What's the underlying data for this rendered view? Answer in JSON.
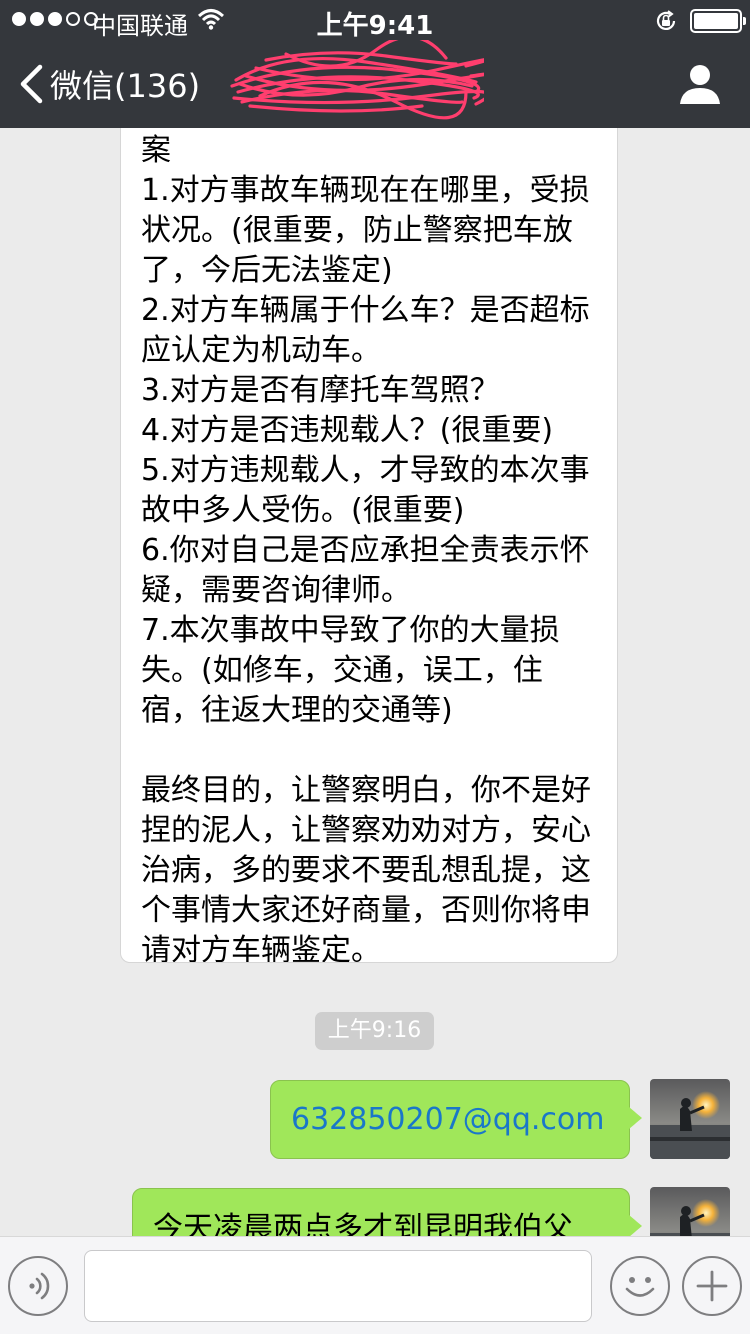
{
  "status_bar": {
    "carrier": "中国联通",
    "time": "上午9:41"
  },
  "nav": {
    "back_label": "微信(136)"
  },
  "messages": {
    "incoming_text": "案\n1.对方事故车辆现在在哪里，受损状况。(很重要，防止警察把车放了，今后无法鉴定)\n2.对方车辆属于什么车？是否超标应认定为机动车。\n3.对方是否有摩托车驾照？\n4.对方是否违规载人？(很重要)\n5.对方违规载人，才导致的本次事故中多人受伤。(很重要)\n6.你对自己是否应承担全责表示怀疑，需要咨询律师。\n7.本次事故中导致了你的大量损失。(如修车，交通，误工，住宿，往返大理的交通等)\n\n最终目的，让警察明白，你不是好捏的泥人，让警察劝劝对方，安心治病，多的要求不要乱想乱提，这个事情大家还好商量，否则你将申请对方车辆鉴定。",
    "timestamp": "上午9:16",
    "outgoing_email": "632850207@qq.com",
    "outgoing_text2": "今天凌晨两点多才到昆明我伯父"
  },
  "icons": {
    "wifi": "wifi-icon",
    "lock": "rotation-lock-icon",
    "battery": "battery-icon",
    "back": "chevron-left-icon",
    "profile": "person-icon",
    "voice": "voice-icon",
    "emoji": "emoji-icon",
    "plus": "plus-icon"
  },
  "colors": {
    "nav_background": "#34373c",
    "chat_background": "#ebebeb",
    "outgoing_bubble": "#a0e75a",
    "link": "#1a77c9",
    "redaction": "#ff3e6e"
  }
}
